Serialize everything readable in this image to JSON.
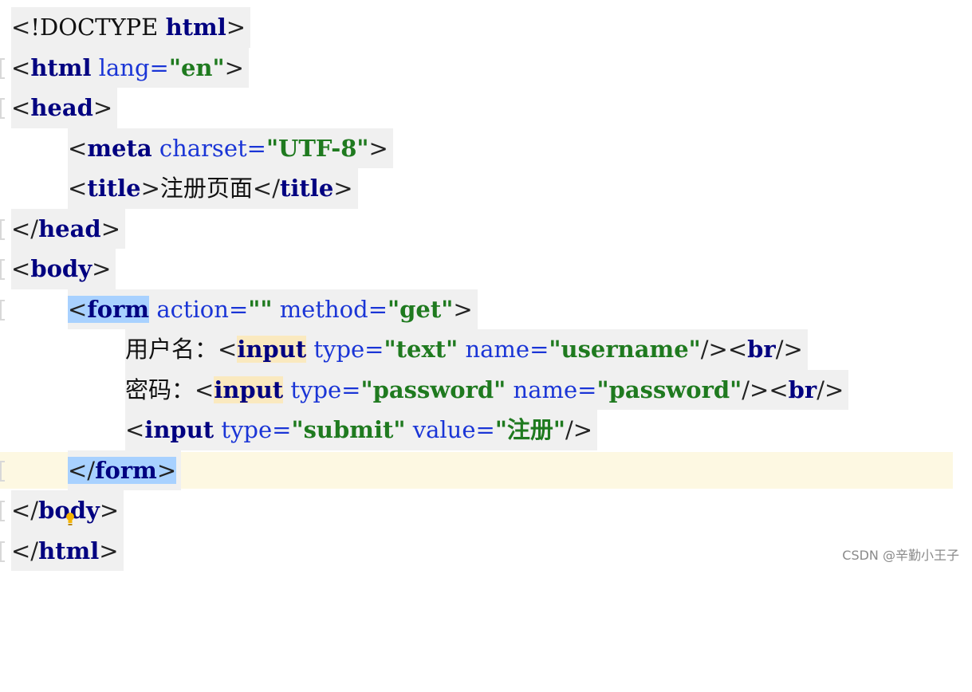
{
  "editor": {
    "language": "html",
    "lines": [
      {
        "parts": [
          {
            "t": "<",
            "k": "br"
          },
          {
            "t": "!DOCTYPE",
            "k": "txt"
          },
          {
            "t": " ",
            "k": "txt"
          },
          {
            "t": "html",
            "k": "tag"
          },
          {
            "t": ">",
            "k": "br"
          }
        ]
      },
      {
        "parts": [
          {
            "t": "<",
            "k": "br"
          },
          {
            "t": "html",
            "k": "tag"
          },
          {
            "t": " ",
            "k": "txt"
          },
          {
            "t": "lang",
            "k": "attr"
          },
          {
            "t": "=",
            "k": "attr"
          },
          {
            "t": "\"en\"",
            "k": "val"
          },
          {
            "t": ">",
            "k": "br"
          }
        ]
      },
      {
        "parts": [
          {
            "t": "<",
            "k": "br"
          },
          {
            "t": "head",
            "k": "tag"
          },
          {
            "t": ">",
            "k": "br"
          }
        ]
      },
      {
        "parts": [
          {
            "t": "<",
            "k": "br"
          },
          {
            "t": "meta",
            "k": "tag"
          },
          {
            "t": " ",
            "k": "txt"
          },
          {
            "t": "charset",
            "k": "attr"
          },
          {
            "t": "=",
            "k": "attr"
          },
          {
            "t": "\"UTF-8\"",
            "k": "val"
          },
          {
            "t": ">",
            "k": "br"
          }
        ]
      },
      {
        "parts": [
          {
            "t": "<",
            "k": "br"
          },
          {
            "t": "title",
            "k": "tag"
          },
          {
            "t": ">",
            "k": "br"
          },
          {
            "t": "注册页面",
            "k": "txt"
          },
          {
            "t": "</",
            "k": "br"
          },
          {
            "t": "title",
            "k": "tag"
          },
          {
            "t": ">",
            "k": "br"
          }
        ]
      },
      {
        "parts": [
          {
            "t": "</",
            "k": "br"
          },
          {
            "t": "head",
            "k": "tag"
          },
          {
            "t": ">",
            "k": "br"
          }
        ]
      },
      {
        "parts": [
          {
            "t": "<",
            "k": "br"
          },
          {
            "t": "body",
            "k": "tag"
          },
          {
            "t": ">",
            "k": "br"
          }
        ]
      },
      {
        "parts": [
          {
            "t": "<",
            "k": "br",
            "h": "sel"
          },
          {
            "t": "form",
            "k": "tag",
            "h": "sel"
          },
          {
            "t": " ",
            "k": "txt"
          },
          {
            "t": "action",
            "k": "attr"
          },
          {
            "t": "=",
            "k": "attr"
          },
          {
            "t": "\"\"",
            "k": "val"
          },
          {
            "t": " ",
            "k": "txt"
          },
          {
            "t": "method",
            "k": "attr"
          },
          {
            "t": "=",
            "k": "attr"
          },
          {
            "t": "\"get\"",
            "k": "val"
          },
          {
            "t": ">",
            "k": "br"
          }
        ]
      },
      {
        "parts": [
          {
            "t": "用户名：",
            "k": "txt"
          },
          {
            "t": "<",
            "k": "br"
          },
          {
            "t": "input",
            "k": "tag",
            "h": "usage"
          },
          {
            "t": " ",
            "k": "txt"
          },
          {
            "t": "type",
            "k": "attr"
          },
          {
            "t": "=",
            "k": "attr"
          },
          {
            "t": "\"text\"",
            "k": "val"
          },
          {
            "t": " ",
            "k": "txt"
          },
          {
            "t": "name",
            "k": "attr"
          },
          {
            "t": "=",
            "k": "attr"
          },
          {
            "t": "\"username\"",
            "k": "val"
          },
          {
            "t": "/><",
            "k": "br"
          },
          {
            "t": "br",
            "k": "tag"
          },
          {
            "t": "/>",
            "k": "br"
          }
        ]
      },
      {
        "parts": [
          {
            "t": "密码：",
            "k": "txt"
          },
          {
            "t": "<",
            "k": "br"
          },
          {
            "t": "input",
            "k": "tag",
            "h": "usage"
          },
          {
            "t": " ",
            "k": "txt"
          },
          {
            "t": "type",
            "k": "attr"
          },
          {
            "t": "=",
            "k": "attr"
          },
          {
            "t": "\"password\"",
            "k": "val"
          },
          {
            "t": " ",
            "k": "txt"
          },
          {
            "t": "name",
            "k": "attr"
          },
          {
            "t": "=",
            "k": "attr"
          },
          {
            "t": "\"password\"",
            "k": "val"
          },
          {
            "t": "/><",
            "k": "br"
          },
          {
            "t": "br",
            "k": "tag"
          },
          {
            "t": "/>",
            "k": "br"
          }
        ]
      },
      {
        "parts": [
          {
            "t": "<",
            "k": "br"
          },
          {
            "t": "input",
            "k": "tag"
          },
          {
            "t": " ",
            "k": "txt"
          },
          {
            "t": "type",
            "k": "attr"
          },
          {
            "t": "=",
            "k": "attr"
          },
          {
            "t": "\"submit\"",
            "k": "val"
          },
          {
            "t": " ",
            "k": "txt"
          },
          {
            "t": "value",
            "k": "attr"
          },
          {
            "t": "=",
            "k": "attr"
          },
          {
            "t": "\"注册\"",
            "k": "val"
          },
          {
            "t": "/>",
            "k": "br"
          }
        ]
      },
      {
        "parts": [
          {
            "t": "</",
            "k": "br",
            "h": "sel"
          },
          {
            "t": "form",
            "k": "tag",
            "h": "sel"
          },
          {
            "t": ">",
            "k": "br",
            "h": "sel"
          }
        ]
      },
      {
        "parts": [
          {
            "t": "</",
            "k": "br"
          },
          {
            "t": "body",
            "k": "tag"
          },
          {
            "t": ">",
            "k": "br"
          }
        ]
      },
      {
        "parts": [
          {
            "t": "</",
            "k": "br"
          },
          {
            "t": "html",
            "k": "tag"
          },
          {
            "t": ">",
            "k": "br"
          }
        ]
      }
    ]
  },
  "watermark": "CSDN @辛勤小王子",
  "colors": {
    "tag": "#000080",
    "attribute": "#1a35d6",
    "value": "#1f7a1f",
    "selection": "#a8d1ff",
    "usage_highlight": "#fae9bf",
    "current_line": "#fdf8e2"
  },
  "icons": {
    "intention": "lightbulb-icon",
    "fold": "fold-marker-icon"
  }
}
